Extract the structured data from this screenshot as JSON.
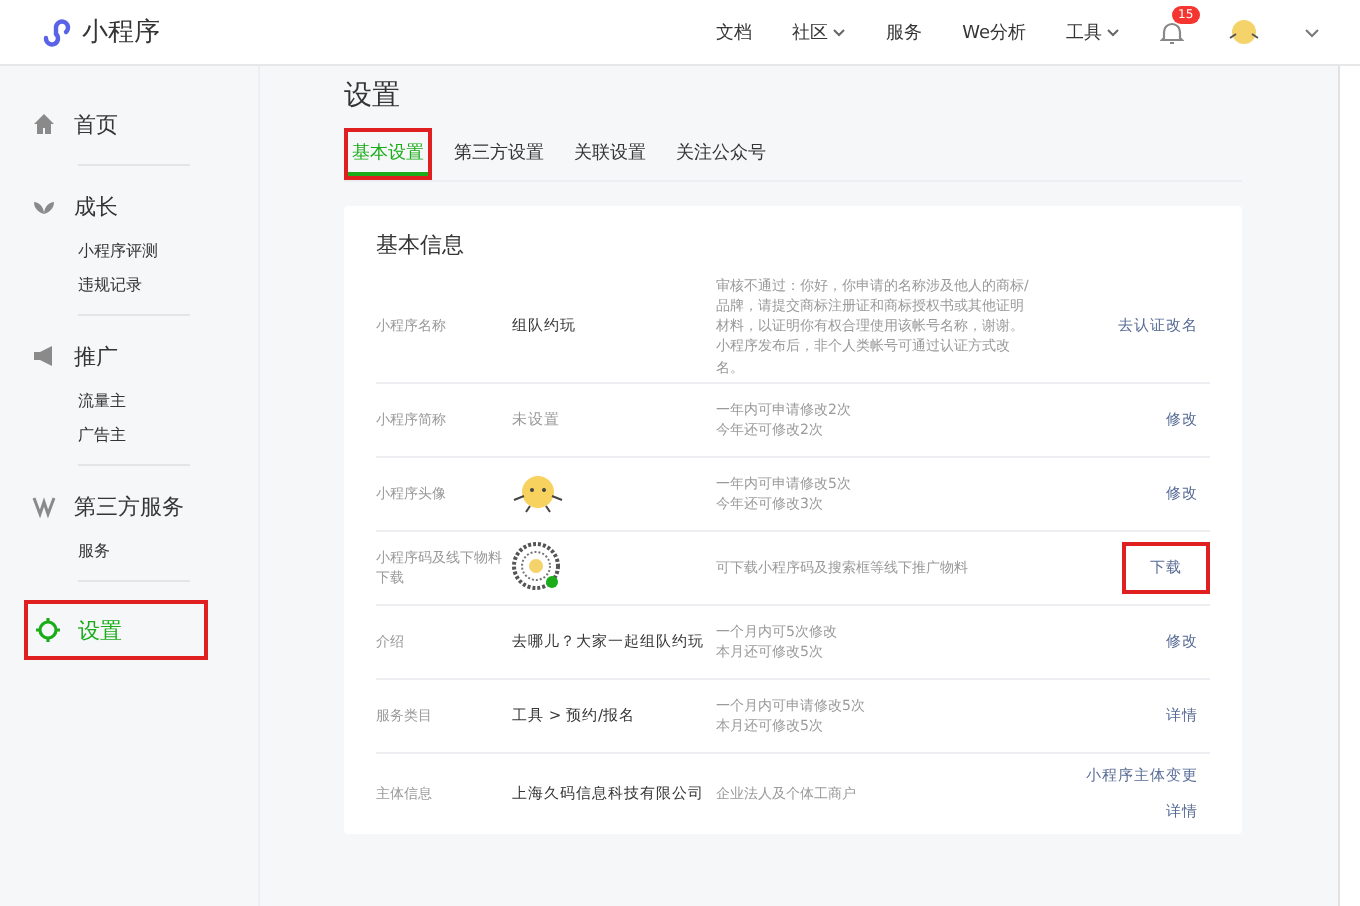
{
  "header": {
    "logo": "小程序",
    "nav": [
      {
        "label": "文档",
        "dropdown": false
      },
      {
        "label": "社区",
        "dropdown": true
      },
      {
        "label": "服务",
        "dropdown": false
      },
      {
        "label": "We分析",
        "dropdown": false
      },
      {
        "label": "工具",
        "dropdown": true
      }
    ],
    "notification_count": "15"
  },
  "sidebar": {
    "sections": [
      {
        "label": "首页",
        "selected": false,
        "highlighted": false
      },
      {
        "label": "成长",
        "selected": false,
        "highlighted": false,
        "children": [
          "小程序评测",
          "违规记录"
        ]
      },
      {
        "label": "推广",
        "selected": false,
        "highlighted": false,
        "children": [
          "流量主",
          "广告主"
        ]
      },
      {
        "label": "第三方服务",
        "selected": false,
        "highlighted": false,
        "children": [
          "服务"
        ]
      },
      {
        "label": "设置",
        "selected": true,
        "highlighted": true
      }
    ]
  },
  "page_title": "设置",
  "tabs": [
    {
      "label": "基本设置",
      "selected": true,
      "highlighted": true
    },
    {
      "label": "第三方设置",
      "selected": false,
      "highlighted": false
    },
    {
      "label": "关联设置",
      "selected": false,
      "highlighted": false
    },
    {
      "label": "关注公众号",
      "selected": false,
      "highlighted": false
    }
  ],
  "card": {
    "title": "基本信息",
    "rows": [
      {
        "label": "小程序名称",
        "kind": "text",
        "value": "组队约玩",
        "muted": false,
        "note": [
          "审核不通过：你好，你申请的名称涉及他人的商标/品牌，请提交商标注册证和商标授权书或其他证明材料，以证明你有权合理使用该帐号名称，谢谢。小程序发布后，非个人类帐号可通过认证方式改名。"
        ],
        "actions": [
          {
            "label": "去认证改名",
            "highlighted": false
          }
        ]
      },
      {
        "label": "小程序简称",
        "kind": "text",
        "value": "未设置",
        "muted": true,
        "note": [
          "一年内可申请修改2次",
          "今年还可修改2次"
        ],
        "actions": [
          {
            "label": "修改",
            "highlighted": false
          }
        ]
      },
      {
        "label": "小程序头像",
        "kind": "avatar",
        "note": [
          "一年内可申请修改5次",
          "今年还可修改3次"
        ],
        "actions": [
          {
            "label": "修改",
            "highlighted": false
          }
        ]
      },
      {
        "label": "小程序码及线下物料下载",
        "kind": "qrcode",
        "note": [
          "可下载小程序码及搜索框等线下推广物料"
        ],
        "actions": [
          {
            "label": "下载",
            "highlighted": true
          }
        ]
      },
      {
        "label": "介绍",
        "kind": "text",
        "value": "去哪儿？大家一起组队约玩",
        "muted": false,
        "note": [
          "一个月内可5次修改",
          "本月还可修改5次"
        ],
        "actions": [
          {
            "label": "修改",
            "highlighted": false
          }
        ]
      },
      {
        "label": "服务类目",
        "kind": "text",
        "value": "工具 > 预约/报名",
        "muted": false,
        "note": [
          "一个月内可申请修改5次",
          "本月还可修改5次"
        ],
        "actions": [
          {
            "label": "详情",
            "highlighted": false
          }
        ]
      },
      {
        "label": "主体信息",
        "kind": "text",
        "value": "上海久码信息科技有限公司",
        "muted": false,
        "note": [
          "企业法人及个体工商户"
        ],
        "actions": [
          {
            "label": "小程序主体变更",
            "highlighted": false
          },
          {
            "label": "详情",
            "highlighted": false
          }
        ]
      }
    ]
  }
}
